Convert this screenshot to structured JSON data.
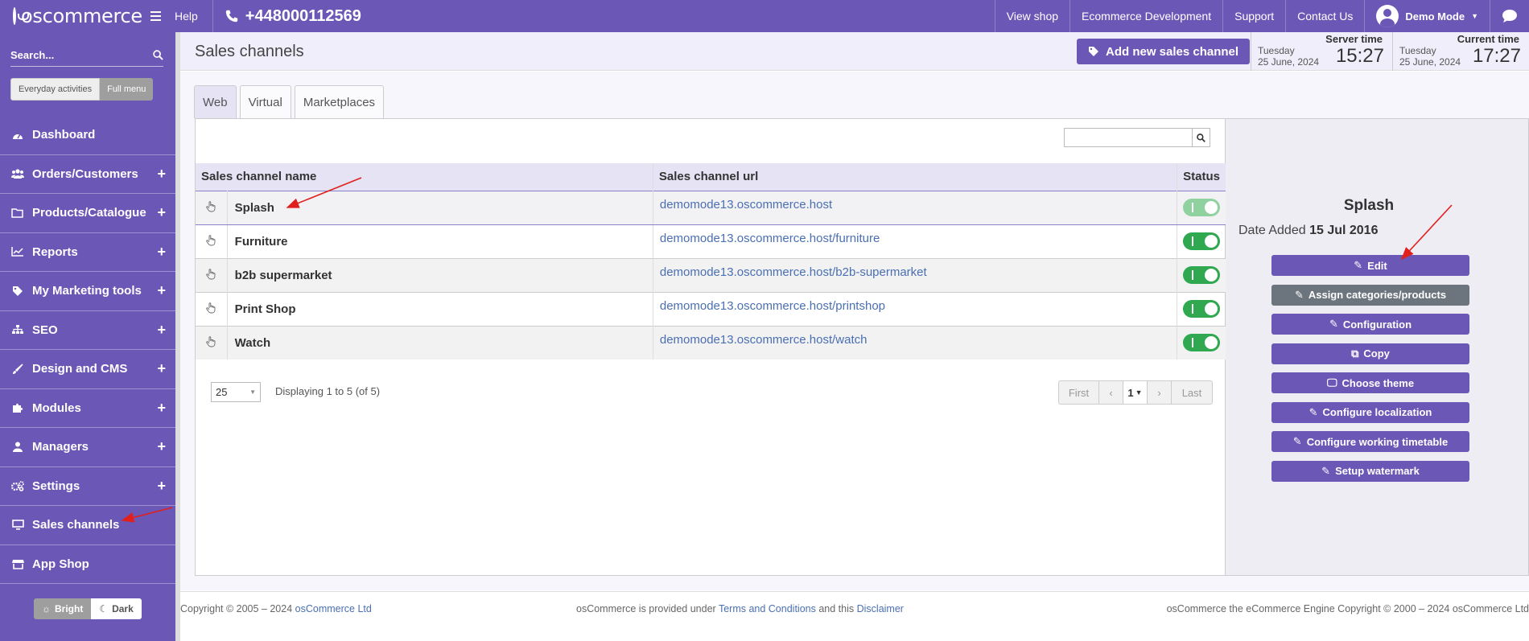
{
  "topbar": {
    "logo": "oscommerce",
    "help": "Help",
    "phone": "+448000112569",
    "links": [
      "View shop",
      "Ecommerce Development",
      "Support",
      "Contact Us"
    ],
    "user": "Demo Mode"
  },
  "sidebar": {
    "search_placeholder": "Search...",
    "mode_everyday": "Everyday activities",
    "mode_full": "Full menu",
    "items": [
      {
        "label": "Dashboard",
        "icon": "dashboard-icon",
        "expandable": false
      },
      {
        "label": "Orders/Customers",
        "icon": "users-icon",
        "expandable": true
      },
      {
        "label": "Products/Catalogue",
        "icon": "folder-icon",
        "expandable": true
      },
      {
        "label": "Reports",
        "icon": "chart-line-icon",
        "expandable": true
      },
      {
        "label": "My Marketing tools",
        "icon": "tag-icon",
        "expandable": true
      },
      {
        "label": "SEO",
        "icon": "sitemap-icon",
        "expandable": true
      },
      {
        "label": "Design and CMS",
        "icon": "brush-icon",
        "expandable": true
      },
      {
        "label": "Modules",
        "icon": "puzzle-icon",
        "expandable": true
      },
      {
        "label": "Managers",
        "icon": "user-icon",
        "expandable": true
      },
      {
        "label": "Settings",
        "icon": "cogs-icon",
        "expandable": true
      },
      {
        "label": "Sales channels",
        "icon": "desktop-icon",
        "expandable": false
      },
      {
        "label": "App Shop",
        "icon": "store-icon",
        "expandable": false
      }
    ],
    "theme_bright": "Bright",
    "theme_dark": "Dark"
  },
  "header": {
    "title": "Sales channels",
    "add_button": "Add new sales channel",
    "server_time_label": "Server time",
    "server_day": "Tuesday",
    "server_date": "25 June, 2024",
    "server_time": "15:27",
    "current_time_label": "Current time",
    "current_day": "Tuesday",
    "current_date": "25 June, 2024",
    "current_time": "17:27"
  },
  "tabs": [
    "Web",
    "Virtual",
    "Marketplaces"
  ],
  "table": {
    "columns": [
      "Sales channel name",
      "Sales channel url",
      "Status"
    ],
    "rows": [
      {
        "name": "Splash",
        "url": "demomode13.oscommerce.host",
        "status_on": true
      },
      {
        "name": "Furniture",
        "url": "demomode13.oscommerce.host/furniture",
        "status_on": true
      },
      {
        "name": "b2b supermarket",
        "url": "demomode13.oscommerce.host/b2b-supermarket",
        "status_on": true
      },
      {
        "name": "Print Shop",
        "url": "demomode13.oscommerce.host/printshop",
        "status_on": true
      },
      {
        "name": "Watch",
        "url": "demomode13.oscommerce.host/watch",
        "status_on": true
      }
    ]
  },
  "pagination": {
    "per_page": "25",
    "displaying": "Displaying 1 to 5 (of 5)",
    "first": "First",
    "page": "1",
    "last": "Last"
  },
  "detail": {
    "title": "Splash",
    "date_added_label": "Date Added",
    "date_added": "15 Jul 2016",
    "actions": [
      "Edit",
      "Assign categories/products",
      "Configuration",
      "Copy",
      "Choose theme",
      "Configure localization",
      "Configure working timetable",
      "Setup watermark"
    ]
  },
  "footer": {
    "copyright_prefix": "Copyright © 2005 – 2024",
    "company": "osCommerce Ltd",
    "mid_prefix": "osCommerce is provided under",
    "terms": "Terms and Conditions",
    "mid_and": "and this",
    "disclaimer": "Disclaimer",
    "right": "osCommerce the eCommerce Engine Copyright © 2000 – 2024 osCommerce Ltd"
  },
  "colors": {
    "brand": "#6b57b5",
    "toggle_on": "#2fa84f",
    "link": "#4a6fb3",
    "annotation_arrow": "#e0201c"
  }
}
